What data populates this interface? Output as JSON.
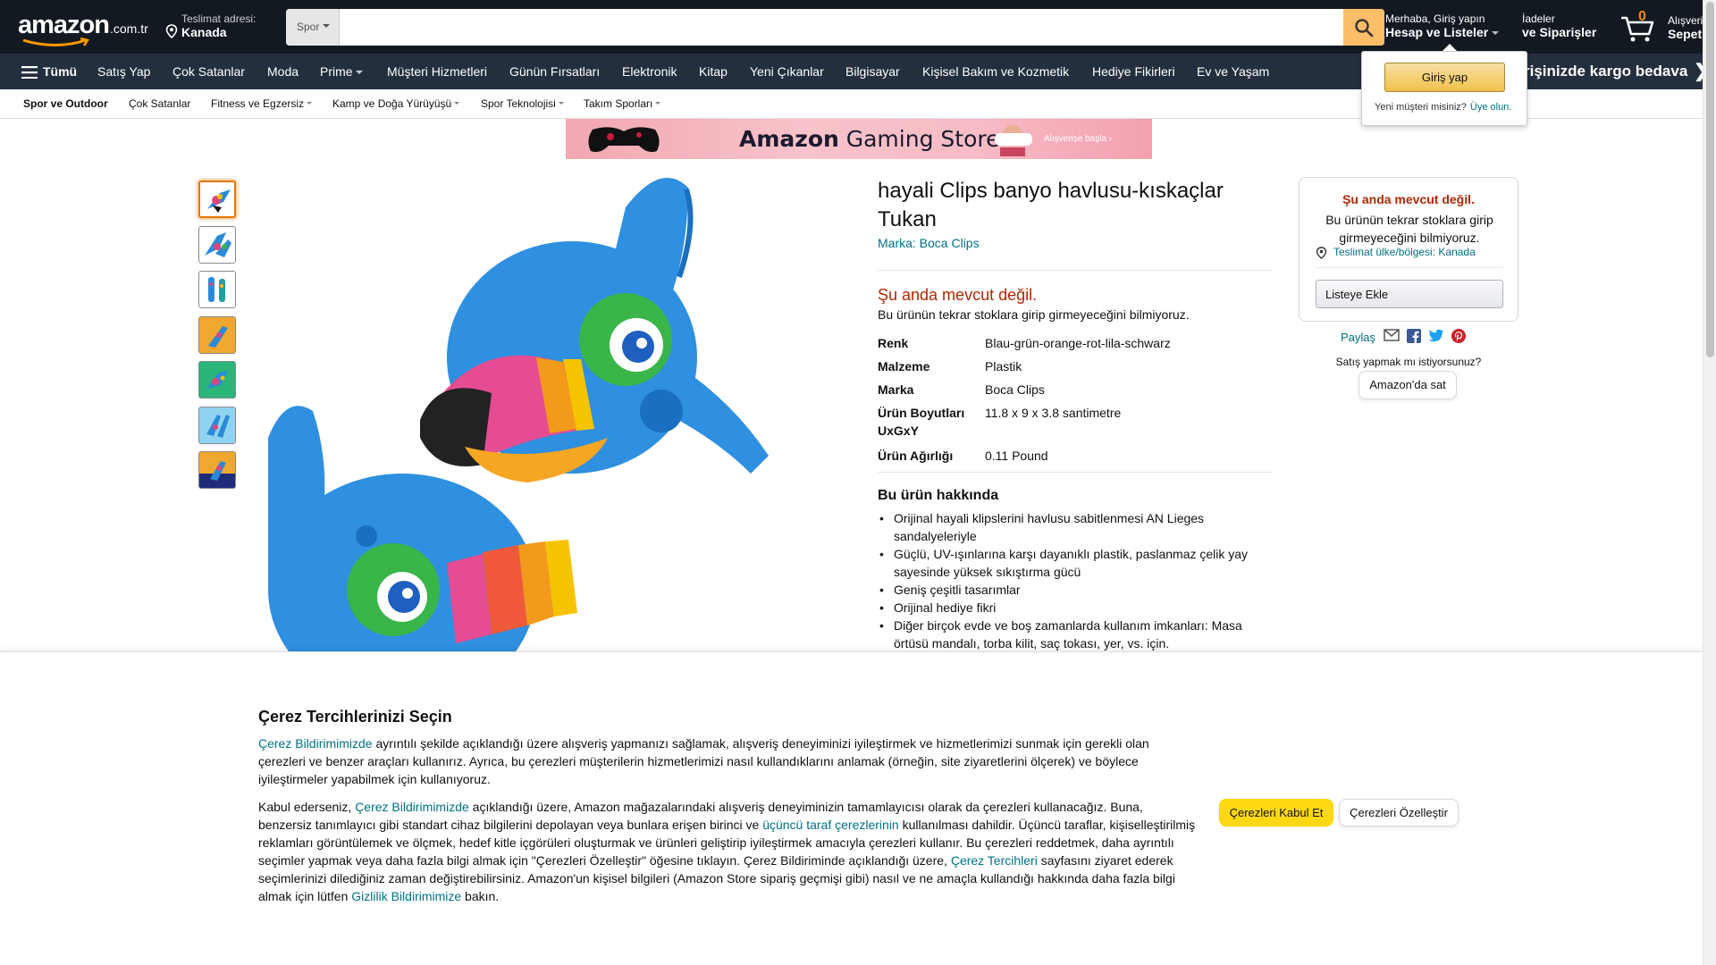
{
  "header": {
    "logo": "amazon",
    "logo_tld": ".com.tr",
    "deliver_label": "Teslimat adresi:",
    "deliver_country": "Kanada",
    "search_category": "Spor",
    "search_placeholder": "",
    "account_greeting": "Merhaba, Giriş yapın",
    "account_label": "Hesap ve Listeler",
    "orders_line1": "İadeler",
    "orders_line2": "ve Siparişler",
    "cart_count": "0",
    "cart_line1": "Alışveriş",
    "cart_line2": "Sepeti"
  },
  "nav": {
    "all": "Tümü",
    "items": [
      "Satış Yap",
      "Çok Satanlar",
      "Moda",
      "Prime",
      "Müşteri Hizmetleri",
      "Günün Fırsatları",
      "Elektronik",
      "Kitap",
      "Yeni Çıkanlar",
      "Bilgisayar",
      "Kişisel Bakım ve Kozmetik",
      "Hediye Fikirleri",
      "Ev ve Yaşam"
    ],
    "promo": "rişinizde kargo bedava",
    "promo_arrow": "❯"
  },
  "subnav": {
    "items": [
      "Spor ve Outdoor",
      "Çok Satanlar",
      "Fitness ve Egzersiz",
      "Kamp ve Doğa Yürüyüşü",
      "Spor Teknolojisi",
      "Takım Sporları"
    ]
  },
  "banner": {
    "title_brand": "Amazon",
    "title_rest": " Gaming Store",
    "cta": "Alışverişe başla ›"
  },
  "product": {
    "title": "hayali Clips banyo havlusu-kıskaçlar Tukan",
    "brand_link": "Marka: Boca Clips",
    "unavailable": "Şu anda mevcut değil.",
    "unavailable_sub": "Bu ürünün tekrar stoklara girip girmeyeceğini bilmiyoruz.",
    "specs": [
      {
        "k": "Renk",
        "v": "Blau-grün-orange-rot-lila-schwarz"
      },
      {
        "k": "Malzeme",
        "v": "Plastik"
      },
      {
        "k": "Marka",
        "v": "Boca Clips"
      },
      {
        "k": "Ürün Boyutları UxGxY",
        "v": "11.8 x 9 x 3.8 santimetre"
      },
      {
        "k": "Ürün Ağırlığı",
        "v": "0.11 Pound"
      }
    ],
    "about_heading": "Bu ürün hakkında",
    "about": [
      "Orijinal hayali klipslerini havlusu sabitlenmesi AN Lieges sandalyeleriyle",
      "Güçlü, UV-ışınlarına karşı dayanıklı plastik, paslanmaz çelik yay sayesinde yüksek sıkıştırma gücü",
      "Geniş çeşitli tasarımlar",
      "Orijinal hediye fikri",
      "Diğer birçok evde ve boş zamanlarda kullanım imkanları: Masa örtüsü mandalı, torba kilit, saç tokası, yer, vs. için."
    ]
  },
  "buybox": {
    "unavailable": "Şu anda mevcut değil.",
    "sub": "Bu ürünün tekrar stoklara girip girmeyeceğini bilmiyoruz.",
    "location": "Teslimat ülke/bölgesi: Kanada",
    "add_to_list": "Listeye Ekle",
    "share": "Paylaş",
    "sell_question": "Satış yapmak mı istiyorsunuz?",
    "sell_button": "Amazon'da sat"
  },
  "flyout": {
    "signin": "Giriş yap",
    "new_customer": "Yeni müşteri misiniz?",
    "signup": "Üye olun."
  },
  "cookie": {
    "title": "Çerez Tercihlerinizi Seçin",
    "p1_link": "Çerez Bildirimimizde",
    "p1_text": " ayrıntılı şekilde açıklandığı üzere alışveriş yapmanızı sağlamak, alışveriş deneyiminizi iyileştirmek ve hizmetlerimizi sunmak için gerekli olan çerezleri ve benzer araçları kullanırız. Ayrıca, bu çerezleri müşterilerin hizmetlerimizi nasıl kullandıklarını anlamak (örneğin, site ziyaretlerini ölçerek) ve böylece iyileştirmeler yapabilmek için kullanıyoruz.",
    "p2_a": "Kabul ederseniz, ",
    "p2_link1": "Çerez Bildirimimizde",
    "p2_b": " açıklandığı üzere, Amazon mağazalarındaki alışveriş deneyiminizin tamamlayıcısı olarak da çerezleri kullanacağız. Buna, benzersiz tanımlayıcı gibi standart cihaz bilgilerini depolayan veya bunlara erişen birinci ve ",
    "p2_link2": "üçüncü taraf çerezlerinin",
    "p2_c": " kullanılması dahildir. Üçüncü taraflar, kişiselleştirilmiş reklamları görüntülemek ve ölçmek, hedef kitle içgörüleri oluşturmak ve ürünleri geliştirip iyileştirmek amacıyla çerezleri kullanır. Bu çerezleri reddetmek, daha ayrıntılı seçimler yapmak veya daha fazla bilgi almak için \"Çerezleri Özelleştir\" öğesine tıklayın. Çerez Bildiriminde açıklandığı üzere, ",
    "p2_link3": "Çerez Tercihleri",
    "p2_d": " sayfasını ziyaret ederek seçimlerinizi dilediğiniz zaman değiştirebilirsiniz. Amazon'un kişisel bilgileri (Amazon Store sipariş geçmişi gibi) nasıl ve ne amaçla kullandığı hakkında daha fazla bilgi almak için lütfen ",
    "p2_link4": "Gizlilik Bildirimimize",
    "p2_e": " bakın.",
    "accept": "Çerezleri Kabul Et",
    "customize": "Çerezleri Özelleştir"
  },
  "colors": {
    "nav_dark": "#131921",
    "nav_mid": "#232f3e",
    "search_button": "#febd69",
    "link": "#007185",
    "unavailable": "#b12704",
    "accept_button": "#ffd814"
  }
}
